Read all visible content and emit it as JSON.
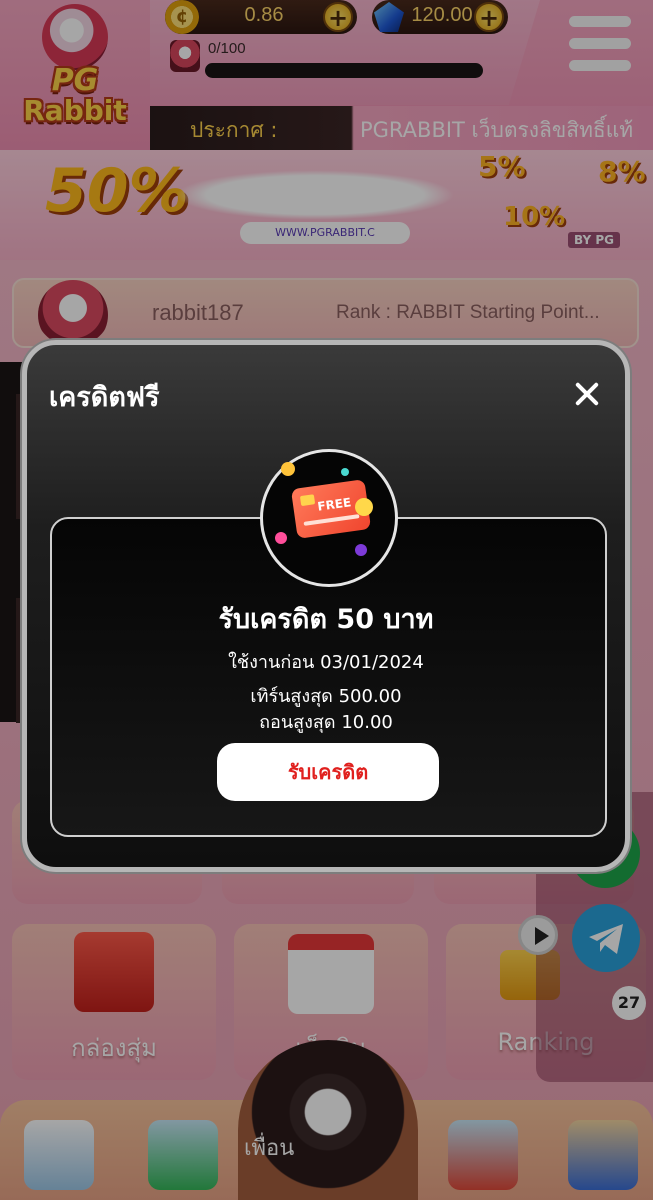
{
  "header": {
    "logo_line1": "PG",
    "logo_line2": "Rabbit",
    "coin_balance": "0.86",
    "gem_balance": "120.00",
    "exp_text": "0/100",
    "exp_progress": 0,
    "announce_label": "ประกาศ :",
    "announce_text": "PGRABBIT เว็บตรงลิขสิทธิ์แท้"
  },
  "banner": {
    "percent_main": "50%",
    "percent_step2": "8%",
    "percent_step1": "5%",
    "percent_step3": "10%",
    "url": "WWW.PGRABBIT.C",
    "brand": "BY PG"
  },
  "user": {
    "username": "rabbit187",
    "rank": "Rank : RABBIT Starting Point..."
  },
  "tiles": {
    "mystery_box": "กล่องสุ่ม",
    "checkin": "เช็คอิน",
    "ranking": "Ranking"
  },
  "nav": {
    "center_label": "เพื่อน"
  },
  "floating": {
    "badge_count": "27"
  },
  "modal": {
    "title": "เครดิตฟรี",
    "card_icon_text": "FREE",
    "promo_title": "รับเครดิต 50 บาท",
    "expire_text": "ใช้งานก่อน 03/01/2024",
    "turnover_text": "เทิร์นสูงสุด 500.00",
    "withdraw_text": "ถอนสูงสุด 10.00",
    "claim_button": "รับเครดิต"
  },
  "colors": {
    "accent_pink": "#f09bbb",
    "claim_red": "#e0201e",
    "gold": "#ffd34d",
    "modal_bg": "#0e0e0e"
  }
}
